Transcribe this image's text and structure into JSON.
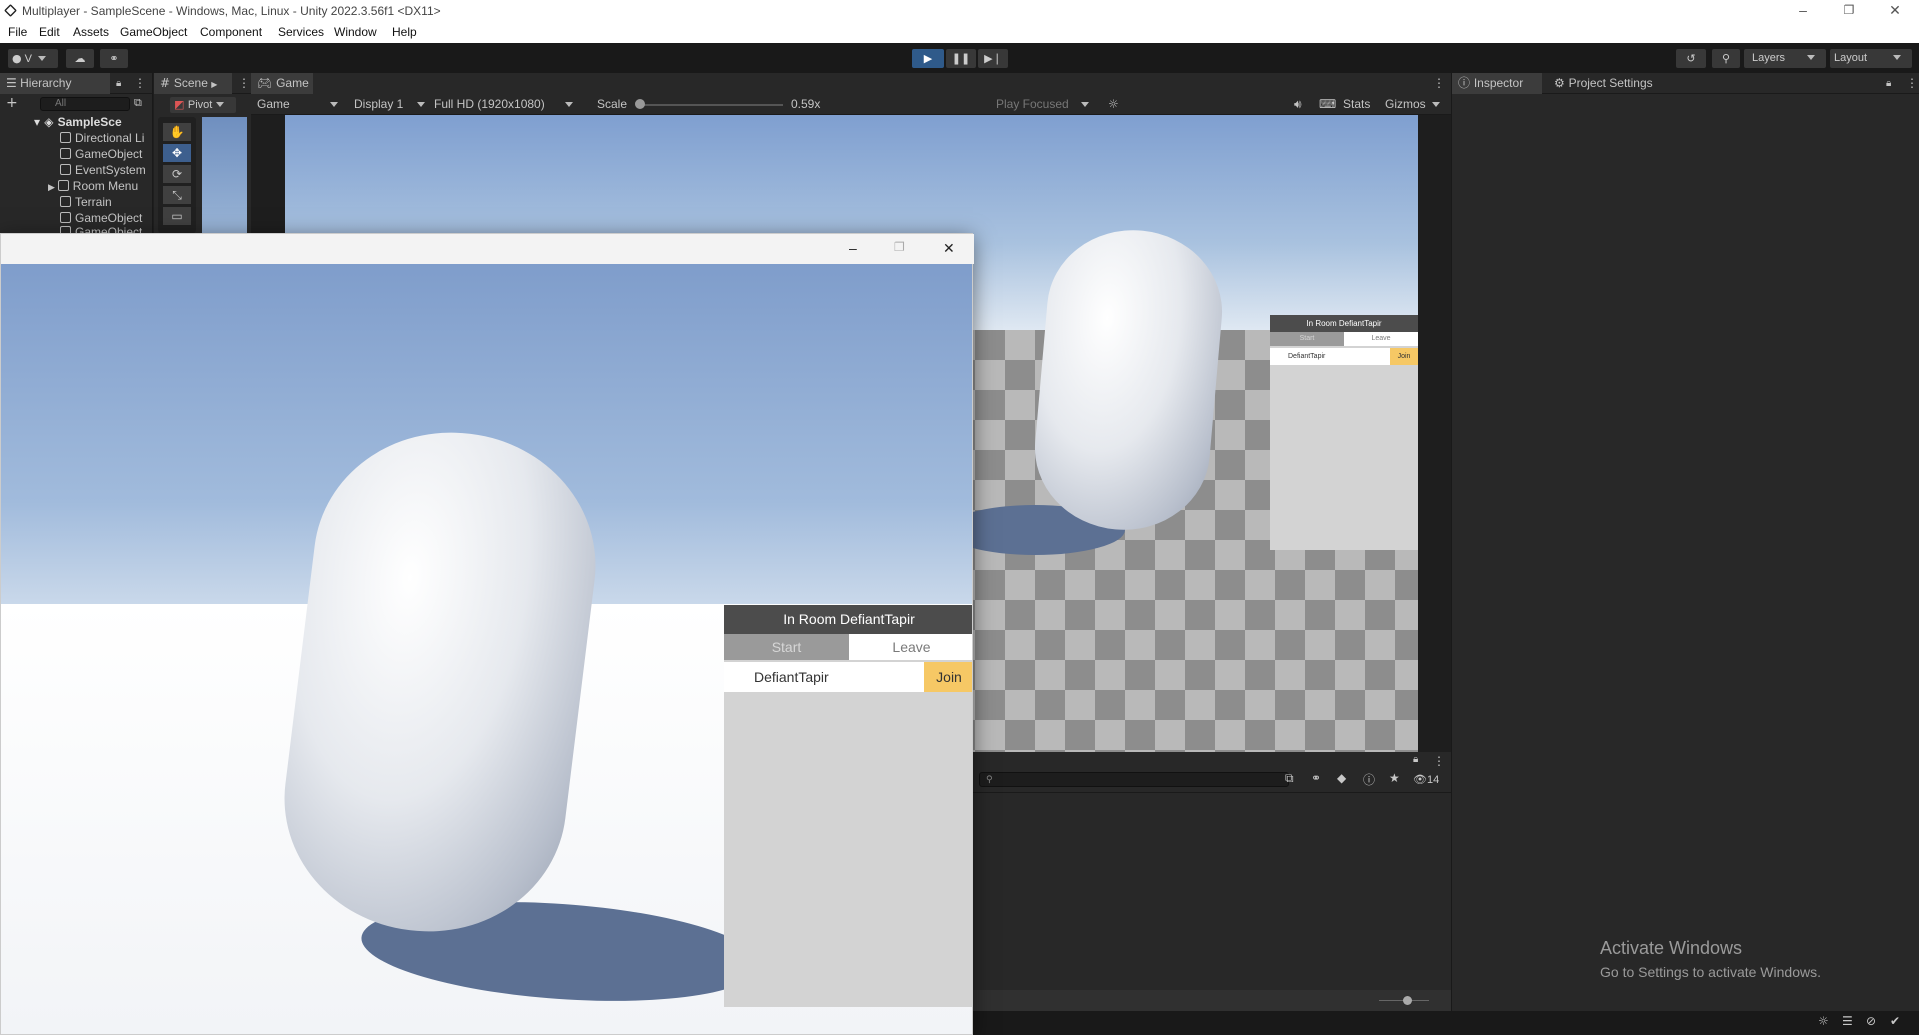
{
  "window": {
    "title": "Multiplayer - SampleScene - Windows, Mac, Linux - Unity 2022.3.56f1 <DX11>",
    "minimize": "–",
    "maximize": "❐",
    "close": "✕"
  },
  "menu": [
    "File",
    "Edit",
    "Assets",
    "GameObject",
    "Component",
    "Services",
    "Window",
    "Help"
  ],
  "toolbar": {
    "account": "V",
    "layers_label": "Layers",
    "layout_label": "Layout"
  },
  "hierarchy": {
    "tab_label": "Hierarchy",
    "search_placeholder": "All",
    "scene": "SampleSce",
    "items": [
      "Directional Li",
      "GameObject",
      "EventSystem",
      "Room Menu",
      "Terrain",
      "GameObject",
      "GameObject"
    ]
  },
  "scene": {
    "tab_label": "Scene",
    "pivot_label": "Pivot"
  },
  "game": {
    "tab_label": "Game",
    "mode": "Game",
    "display": "Display 1",
    "resolution": "Full HD (1920x1080)",
    "scale_label": "Scale",
    "scale_value": "0.59x",
    "scale_fraction": 0.02,
    "play_mode": "Play Focused",
    "stats": "Stats",
    "gizmos": "Gizmos"
  },
  "room_menu": {
    "title": "In Room DefiantTapir",
    "start": "Start",
    "leave": "Leave",
    "player": "DefiantTapir",
    "join": "Join"
  },
  "room_menu_small": {
    "title": "In Room DefiantTapir",
    "start": "Start",
    "leave": "Leave",
    "player": "DefiantTapir",
    "join": "Join"
  },
  "inspector": {
    "tab_label": "Inspector",
    "project_settings_label": "Project Settings"
  },
  "console": {
    "count": "14",
    "zoom_fraction": 0.55
  },
  "watermark": {
    "line1": "Activate Windows",
    "line2": "Go to Settings to activate Windows."
  },
  "colors": {
    "join": "#f6c865",
    "header": "#4c4c4c",
    "play_active": "#2f5a8a"
  }
}
